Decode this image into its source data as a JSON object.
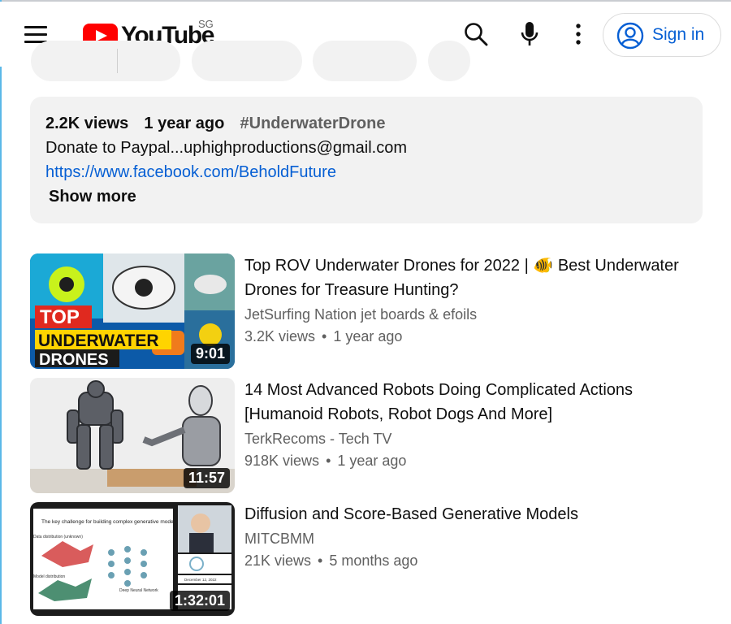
{
  "header": {
    "logo_text": "YouTube",
    "region": "SG",
    "sign_in_label": "Sign in",
    "brand_color": "#ff0000",
    "link_color": "#065fd4"
  },
  "icons": {
    "menu": "hamburger-menu-icon",
    "search": "search-icon",
    "voice": "microphone-icon",
    "more": "more-vertical-icon",
    "account": "account-circle-icon"
  },
  "description": {
    "views": "2.2K views",
    "age": "1 year ago",
    "hashtag": "#UnderwaterDrone",
    "text": "Donate to Paypal...uphighproductions@gmail.com",
    "link": "https://www.facebook.com/BeholdFuture",
    "show_more": "Show more"
  },
  "videos": [
    {
      "title": "Top ROV Underwater Drones for 2022 | 🐠 Best Underwater Drones for Treasure Hunting?",
      "channel": "JetSurfing Nation jet boards & efoils",
      "views": "3.2K views",
      "age": "1 year ago",
      "duration": "9:01",
      "thumb_text_1": "TOP",
      "thumb_text_2": "UNDERWATER",
      "thumb_text_3": "DRONES"
    },
    {
      "title": "14 Most Advanced Robots Doing Complicated Actions [Humanoid Robots, Robot Dogs And More]",
      "channel": "TerkRecoms - Tech TV",
      "views": "918K views",
      "age": "1 year ago",
      "duration": "11:57"
    },
    {
      "title": "Diffusion and Score-Based Generative Models",
      "channel": "MITCBMM",
      "views": "21K views",
      "age": "5 months ago",
      "duration": "1:32:01",
      "slide_title": "The key challenge for building complex generative models",
      "slide_label_1": "Data distribution (unknown)",
      "slide_label_2": "Model distribution",
      "slide_label_3": "Deep Neural Network",
      "slide_date": "December 12, 2022"
    }
  ]
}
